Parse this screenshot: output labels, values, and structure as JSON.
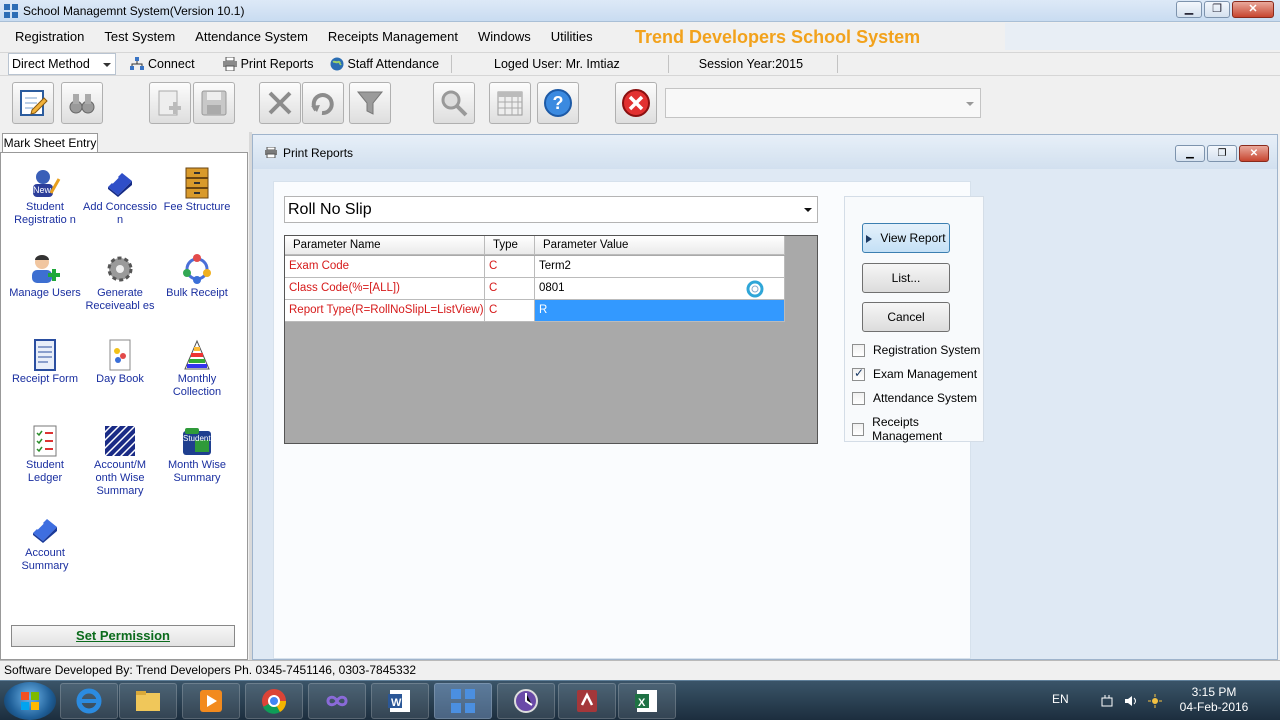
{
  "window": {
    "title": "School Managemnt System(Version 10.1)"
  },
  "menu": {
    "items": [
      "Registration",
      "Test System",
      "Attendance System",
      "Receipts Management",
      "Windows",
      "Utilities"
    ],
    "brand": "Trend Developers School System"
  },
  "quickbar": {
    "method_select": "Direct Method",
    "connect": "Connect",
    "print_reports": "Print Reports",
    "staff_attendance": "Staff Attendance",
    "logged_user": "Loged User: Mr. Imtiaz",
    "session": "Session Year:2015"
  },
  "left_panel": {
    "tab": "Mark Sheet Entry",
    "items": [
      {
        "label": "Student Registratio n",
        "icon": "student-registration-icon"
      },
      {
        "label": "Add Concessio n",
        "icon": "eraser-icon"
      },
      {
        "label": "Fee Structure",
        "icon": "cabinet-icon"
      },
      {
        "label": "Manage Users",
        "icon": "user-add-icon"
      },
      {
        "label": "Generate Receiveabl es",
        "icon": "gear-icon"
      },
      {
        "label": "Bulk Receipt",
        "icon": "network-icon"
      },
      {
        "label": "Receipt Form",
        "icon": "form-icon"
      },
      {
        "label": "Day Book",
        "icon": "book-icon"
      },
      {
        "label": "Monthly Collection",
        "icon": "palette-icon"
      },
      {
        "label": "Student Ledger",
        "icon": "checklist-icon"
      },
      {
        "label": "Account/M onth Wise Summary",
        "icon": "pattern-icon"
      },
      {
        "label": "Month Wise Summary",
        "icon": "student-folder-icon"
      },
      {
        "label": "Account Summary",
        "icon": "eraser-blue-icon"
      }
    ],
    "set_permission": "Set Permission"
  },
  "child": {
    "title": "Print Reports",
    "report_select": "Roll No Slip",
    "grid": {
      "headers": [
        "Parameter Name",
        "Type",
        "Parameter Value"
      ],
      "rows": [
        {
          "name": "Exam Code",
          "type": "C",
          "value": "Term2"
        },
        {
          "name": "Class Code(%=[ALL])",
          "type": "C",
          "value": "0801"
        },
        {
          "name": "Report Type(R=RollNoSlipL=ListView)",
          "type": "C",
          "value": "R"
        }
      ]
    },
    "buttons": {
      "view": "View Report",
      "list": "List...",
      "cancel": "Cancel"
    },
    "checks": [
      {
        "label": "Registration System",
        "checked": false
      },
      {
        "label": "Exam Management",
        "checked": true
      },
      {
        "label": "Attendance System",
        "checked": false
      },
      {
        "label": "Receipts Management",
        "checked": false
      }
    ]
  },
  "status": "Software Developed By: Trend Developers Ph. 0345-7451146, 0303-7845332",
  "taskbar": {
    "lang": "EN",
    "time": "3:15 PM",
    "date": "04-Feb-2016"
  }
}
